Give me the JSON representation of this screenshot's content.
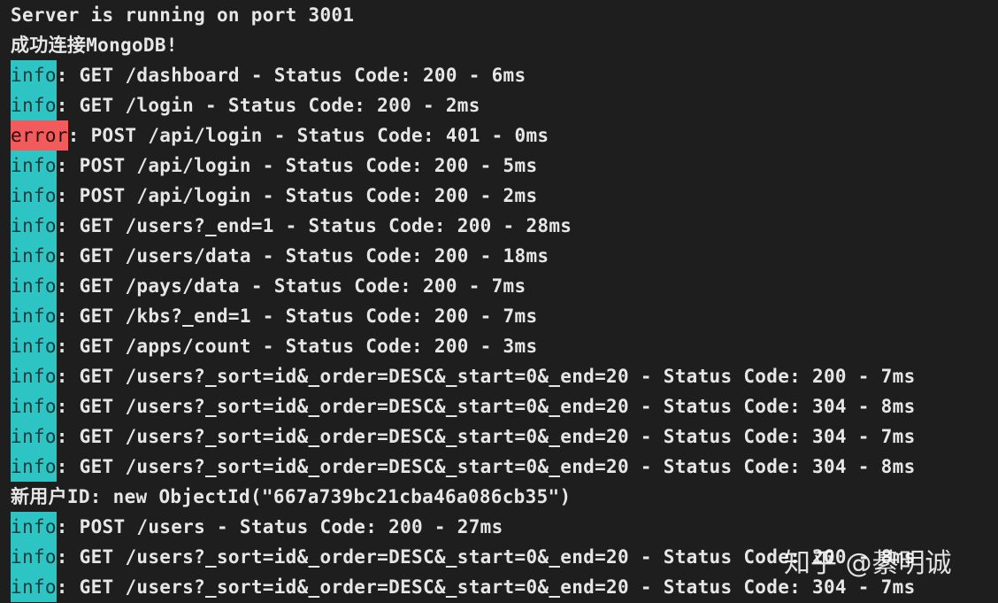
{
  "lines": [
    {
      "tag": "",
      "text": "Server is running on port 3001"
    },
    {
      "tag": "",
      "text": "成功连接MongoDB!"
    },
    {
      "tag": "info",
      "text": ": GET /dashboard - Status Code: 200 - 6ms"
    },
    {
      "tag": "info",
      "text": ": GET /login - Status Code: 200 - 2ms"
    },
    {
      "tag": "error",
      "text": ": POST /api/login - Status Code: 401 - 0ms"
    },
    {
      "tag": "info",
      "text": ": POST /api/login - Status Code: 200 - 5ms"
    },
    {
      "tag": "info",
      "text": ": POST /api/login - Status Code: 200 - 2ms"
    },
    {
      "tag": "info",
      "text": ": GET /users?_end=1 - Status Code: 200 - 28ms"
    },
    {
      "tag": "info",
      "text": ": GET /users/data - Status Code: 200 - 18ms"
    },
    {
      "tag": "info",
      "text": ": GET /pays/data - Status Code: 200 - 7ms"
    },
    {
      "tag": "info",
      "text": ": GET /kbs?_end=1 - Status Code: 200 - 7ms"
    },
    {
      "tag": "info",
      "text": ": GET /apps/count - Status Code: 200 - 3ms"
    },
    {
      "tag": "info",
      "text": ": GET /users?_sort=id&_order=DESC&_start=0&_end=20 - Status Code: 200 - 7ms"
    },
    {
      "tag": "info",
      "text": ": GET /users?_sort=id&_order=DESC&_start=0&_end=20 - Status Code: 304 - 8ms"
    },
    {
      "tag": "info",
      "text": ": GET /users?_sort=id&_order=DESC&_start=0&_end=20 - Status Code: 304 - 7ms"
    },
    {
      "tag": "info",
      "text": ": GET /users?_sort=id&_order=DESC&_start=0&_end=20 - Status Code: 304 - 8ms"
    },
    {
      "tag": "",
      "text": "新用户ID: new ObjectId(\"667a739bc21cba46a086cb35\")"
    },
    {
      "tag": "info",
      "text": ": POST /users - Status Code: 200 - 27ms"
    },
    {
      "tag": "info",
      "text": ": GET /users?_sort=id&_order=DESC&_start=0&_end=20 - Status Code: 200 - 8ms"
    },
    {
      "tag": "info",
      "text": ": GET /users?_sort=id&_order=DESC&_start=0&_end=20 - Status Code: 304 - 7ms"
    }
  ],
  "tags": {
    "info": "info",
    "error": "error"
  },
  "colors": {
    "background": "#1e1e1e",
    "text": "#e6e6e6",
    "info_tag": "#2ec4c4",
    "error_tag": "#f25b5b"
  },
  "watermark": "知乎 @綦明诚"
}
